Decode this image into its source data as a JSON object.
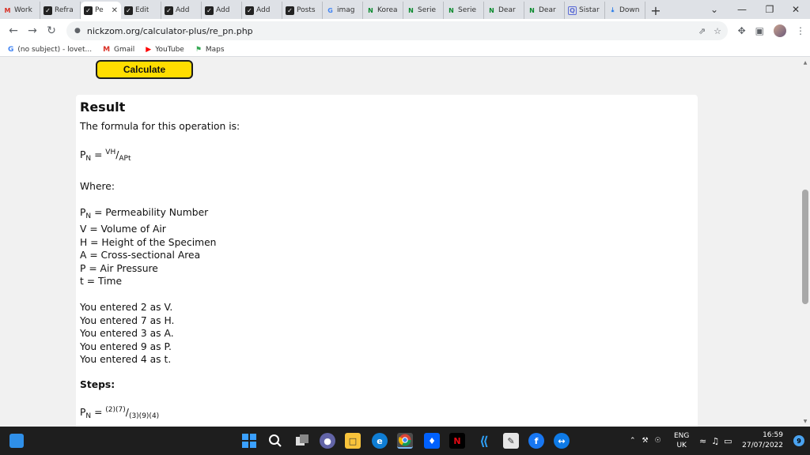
{
  "tabs": [
    {
      "icon": "gmail-icon",
      "glyph": "M",
      "label": "Work",
      "active": false
    },
    {
      "icon": "dark-app-icon",
      "glyph": "✓",
      "label": "Refra",
      "active": false
    },
    {
      "icon": "dark-app-icon",
      "glyph": "✓",
      "label": "Pe",
      "active": true
    },
    {
      "icon": "dark-app-icon",
      "glyph": "✓",
      "label": "Edit",
      "active": false
    },
    {
      "icon": "dark-app-icon",
      "glyph": "✓",
      "label": "Add",
      "active": false
    },
    {
      "icon": "dark-app-icon",
      "glyph": "✓",
      "label": "Add",
      "active": false
    },
    {
      "icon": "dark-app-icon",
      "glyph": "✓",
      "label": "Add",
      "active": false
    },
    {
      "icon": "dark-app-icon",
      "glyph": "✓",
      "label": "Posts",
      "active": false
    },
    {
      "icon": "google-icon",
      "glyph": "G",
      "label": "imag",
      "active": false
    },
    {
      "icon": "nickzom-n-icon",
      "glyph": "N",
      "label": "Korea",
      "active": false
    },
    {
      "icon": "nickzom-n-icon",
      "glyph": "N",
      "label": "Serie",
      "active": false
    },
    {
      "icon": "nickzom-n-icon",
      "glyph": "N",
      "label": "Serie",
      "active": false
    },
    {
      "icon": "nickzom-n-icon",
      "glyph": "N",
      "label": "Dear",
      "active": false
    },
    {
      "icon": "nickzom-n-icon",
      "glyph": "N",
      "label": "Dear",
      "active": false
    },
    {
      "icon": "square-icon",
      "glyph": "Q",
      "label": "Sistar",
      "active": false
    },
    {
      "icon": "download-icon",
      "glyph": "⤓",
      "label": "Down",
      "active": false
    }
  ],
  "window": {
    "minimize": "—",
    "restore": "❐",
    "close": "✕",
    "dropdown": "⌄",
    "new_tab": "+"
  },
  "toolbar": {
    "back": "←",
    "forward": "→",
    "reload": "↻",
    "url": "nickzom.org/calculator-plus/re_pn.php",
    "share": "⇗",
    "star": "☆",
    "extensions": "✥",
    "sidepanel": "▣",
    "menu": "⋮"
  },
  "bookmarks": [
    {
      "icon": "google-icon",
      "glyph": "G",
      "label": "(no subject) - lovet...",
      "color": "#4285f4"
    },
    {
      "icon": "gmail-icon",
      "glyph": "M",
      "label": "Gmail",
      "color": "#d93025"
    },
    {
      "icon": "youtube-icon",
      "glyph": "▶",
      "label": "YouTube",
      "color": "#ff0000"
    },
    {
      "icon": "maps-icon",
      "glyph": "⚑",
      "label": "Maps",
      "color": "#34a853"
    }
  ],
  "page": {
    "calculate_label": "Calculate",
    "result_title": "Result",
    "formula_intro": "The formula for this operation is:",
    "formula": {
      "lhs": "P",
      "lhs_sub": "N",
      "eq": " = ",
      "num": "VH",
      "slash": "/",
      "den": "APt"
    },
    "where_label": "Where:",
    "definitions": [
      {
        "sym": "P",
        "sub": "N",
        "text": " = Permeability Number"
      },
      {
        "sym": "V",
        "sub": "",
        "text": " = Volume of Air"
      },
      {
        "sym": "H",
        "sub": "",
        "text": " = Height of the Specimen"
      },
      {
        "sym": "A",
        "sub": "",
        "text": " = Cross-sectional Area"
      },
      {
        "sym": "P",
        "sub": "",
        "text": " = Air Pressure"
      },
      {
        "sym": "t",
        "sub": "",
        "text": " = Time"
      }
    ],
    "entered": [
      "You entered 2 as V.",
      "You entered 7 as H.",
      "You entered 3 as A.",
      "You entered 9 as P.",
      "You entered 4 as t."
    ],
    "steps_label": "Steps:",
    "step1": {
      "lhs": "P",
      "lhs_sub": "N",
      "eq": " = ",
      "num": "(2)(7)",
      "slash": "/",
      "den": "(3)(9)(4)"
    }
  },
  "taskbar": {
    "tray_lang": "ENG",
    "tray_region": "UK",
    "time": "16:59",
    "date": "27/07/2022",
    "notifications": "9",
    "accent": "#1e1e1e"
  }
}
